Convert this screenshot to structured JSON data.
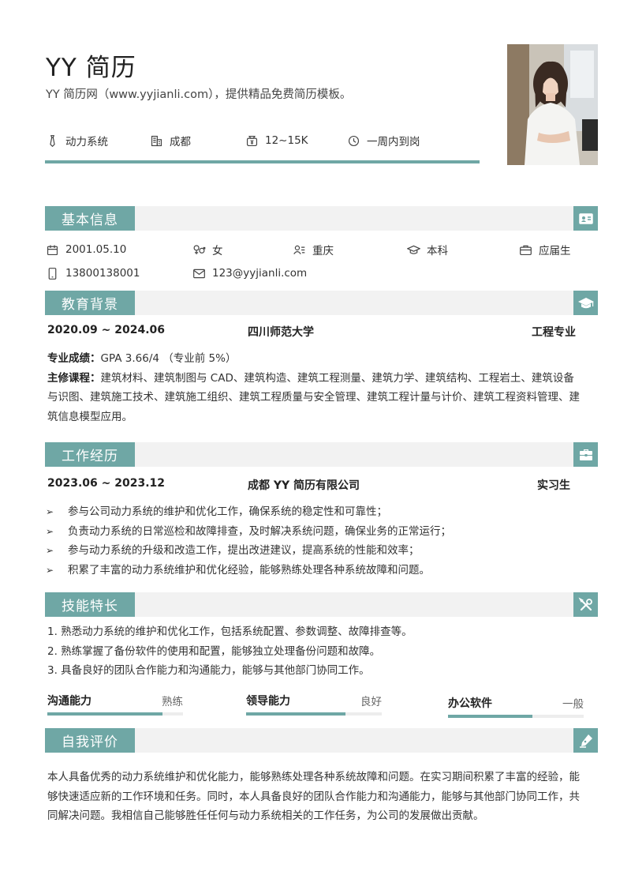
{
  "header": {
    "name": "YY 简历",
    "subtitle": "YY 简历网（www.yyjianli.com），提供精品免费简历模板。",
    "tags": [
      {
        "icon": "tie-icon",
        "label": "动力系统"
      },
      {
        "icon": "building-icon",
        "label": "成都"
      },
      {
        "icon": "money-bag-icon",
        "label": "12~15K"
      },
      {
        "icon": "clock-icon",
        "label": "一周内到岗"
      }
    ]
  },
  "basic": {
    "title": "基本信息",
    "birth": "2001.05.10",
    "gender": "女",
    "hometown": "重庆",
    "degree": "本科",
    "status": "应届生",
    "phone": "13800138001",
    "email": "123@yyjianli.com"
  },
  "education": {
    "title": "教育背景",
    "period": "2020.09 ~ 2024.06",
    "school": "四川师范大学",
    "major": "工程专业",
    "score_label": "专业成绩：",
    "score_value": "GPA 3.66/4 （专业前 5%）",
    "courses_label": "主修课程：",
    "courses_value": "建筑材料、建筑制图与 CAD、建筑构造、建筑工程测量、建筑力学、建筑结构、工程岩土、建筑设备与识图、建筑施工技术、建筑施工组织、建筑工程质量与安全管理、建筑工程计量与计价、建筑工程资料管理、建筑信息模型应用。"
  },
  "work": {
    "title": "工作经历",
    "period": "2023.06 ~ 2023.12",
    "company": "成都 YY 简历有限公司",
    "role": "实习生",
    "bullets": [
      "参与公司动力系统的维护和优化工作，确保系统的稳定性和可靠性；",
      "负责动力系统的日常巡检和故障排查，及时解决系统问题，确保业务的正常运行；",
      "参与动力系统的升级和改造工作，提出改进建议，提高系统的性能和效率；",
      "积累了丰富的动力系统维护和优化经验，能够熟练处理各种系统故障和问题。"
    ]
  },
  "skills": {
    "title": "技能特长",
    "items": [
      "1.  熟悉动力系统的维护和优化工作，包括系统配置、参数调整、故障排查等。",
      "2.  熟练掌握了备份软件的使用和配置，能够独立处理备份问题和故障。",
      "3.  具备良好的团队合作能力和沟通能力，能够与其他部门协同工作。"
    ],
    "bars": [
      {
        "name": "沟通能力",
        "level": "熟练",
        "value": 0.85
      },
      {
        "name": "领导能力",
        "level": "良好",
        "value": 0.73
      },
      {
        "name": "办公软件",
        "level": "一般",
        "value": 0.62
      }
    ]
  },
  "self": {
    "title": "自我评价",
    "text": "本人具备优秀的动力系统维护和优化能力，能够熟练处理各种系统故障和问题。在实习期间积累了丰富的经验，能够快速适应新的工作环境和任务。同时，本人具备良好的团队合作能力和沟通能力，能够与其他部门协同工作，共同解决问题。我相信自己能够胜任任何与动力系统相关的工作任务，为公司的发展做出贡献。"
  },
  "colors": {
    "accent": "#6fa7a5",
    "section_bg": "#f2f2f2"
  }
}
